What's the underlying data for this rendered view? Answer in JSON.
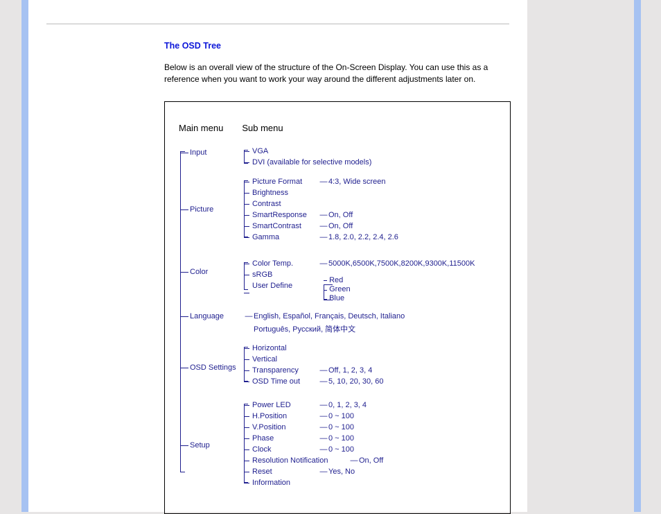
{
  "heading": "The OSD Tree",
  "intro": "Below is an overall view of the structure of the On-Screen Display. You can use this as a reference when you want to work your way around the different adjustments later on.",
  "columns": {
    "main": "Main menu",
    "sub": "Sub menu"
  },
  "tree": {
    "input": {
      "label": "Input",
      "items": [
        {
          "label": "VGA"
        },
        {
          "label": "DVI (available for selective models)"
        }
      ]
    },
    "picture": {
      "label": "Picture",
      "items": [
        {
          "label": "Picture Format",
          "value": "4:3, Wide screen"
        },
        {
          "label": "Brightness"
        },
        {
          "label": "Contrast"
        },
        {
          "label": "SmartResponse",
          "value": "On, Off"
        },
        {
          "label": "SmartContrast",
          "value": "On, Off"
        },
        {
          "label": "Gamma",
          "value": "1.8, 2.0, 2.2, 2.4, 2.6"
        }
      ]
    },
    "color": {
      "label": "Color",
      "items": [
        {
          "label": "Color Temp.",
          "value": "5000K,6500K,7500K,8200K,9300K,11500K"
        },
        {
          "label": "sRGB"
        },
        {
          "label": "User Define",
          "children": [
            "Red",
            "Green",
            "Blue"
          ]
        }
      ]
    },
    "language": {
      "label": "Language",
      "value_line1": "English, Español, Français, Deutsch, Italiano",
      "value_line2": "Português, Русский, 简体中文"
    },
    "osd_settings": {
      "label": "OSD Settings",
      "items": [
        {
          "label": "Horizontal"
        },
        {
          "label": "Vertical"
        },
        {
          "label": "Transparency",
          "value": "Off, 1, 2, 3, 4"
        },
        {
          "label": "OSD Time out",
          "value": "5, 10, 20, 30, 60"
        }
      ]
    },
    "setup": {
      "label": "Setup",
      "items": [
        {
          "label": "Power LED",
          "value": "0, 1, 2, 3, 4"
        },
        {
          "label": "H.Position",
          "value": "0 ~ 100"
        },
        {
          "label": "V.Position",
          "value": "0 ~ 100"
        },
        {
          "label": "Phase",
          "value": "0 ~ 100"
        },
        {
          "label": "Clock",
          "value": "0 ~ 100"
        },
        {
          "label": "Resolution Notification",
          "value": "On, Off"
        },
        {
          "label": "Reset",
          "value": "Yes, No"
        },
        {
          "label": "Information"
        }
      ]
    }
  }
}
